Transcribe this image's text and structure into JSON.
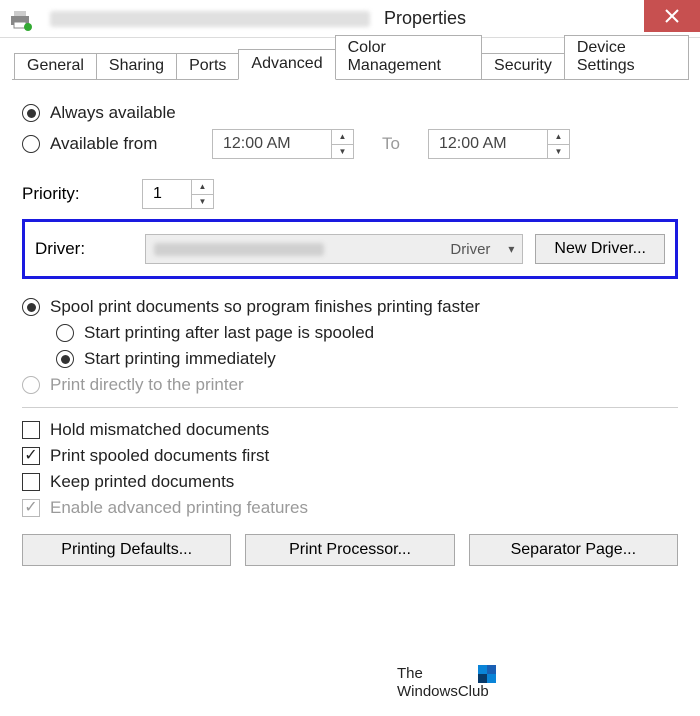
{
  "titlebar": {
    "title_suffix": "Properties"
  },
  "tabs": {
    "t0": "General",
    "t1": "Sharing",
    "t2": "Ports",
    "t3": "Advanced",
    "t4": "Color Management",
    "t5": "Security",
    "t6": "Device Settings"
  },
  "availability": {
    "always_label": "Always available",
    "from_label": "Available from",
    "time_from": "12:00 AM",
    "to_label": "To",
    "time_to": "12:00 AM"
  },
  "priority": {
    "label": "Priority:",
    "value": "1"
  },
  "driver": {
    "label": "Driver:",
    "selected_suffix": "Driver",
    "new_driver_btn": "New Driver..."
  },
  "spool": {
    "opt_spool": "Spool print documents so program finishes printing faster",
    "opt_after": "Start printing after last page is spooled",
    "opt_immediate": "Start printing immediately",
    "opt_direct": "Print directly to the printer"
  },
  "checks": {
    "hold": "Hold mismatched documents",
    "spooled_first": "Print spooled documents first",
    "keep": "Keep printed documents",
    "adv_features": "Enable advanced printing features"
  },
  "buttons": {
    "defaults": "Printing Defaults...",
    "processor": "Print Processor...",
    "separator": "Separator Page..."
  },
  "watermark": {
    "line1": "The",
    "line2": "WindowsClub"
  }
}
